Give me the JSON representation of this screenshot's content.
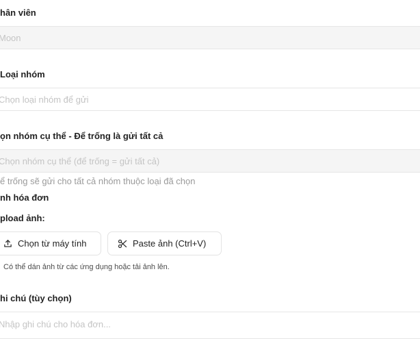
{
  "employee": {
    "label": "hân viên",
    "value": "Moon"
  },
  "group_type": {
    "label": "Loại nhóm",
    "placeholder": "Chọn loại nhóm để gửi"
  },
  "specific_group": {
    "label": "ọn nhóm cụ thể - Để trống là gửi tất cả",
    "placeholder": "Chọn nhóm cụ thể (để trống = gửi tất cả)",
    "hint": "ể trống sẽ gửi cho tất cả nhóm thuộc loại đã chọn"
  },
  "invoice_image": {
    "section_label": "nh hóa đơn",
    "upload_label": "pload ảnh:",
    "choose_button": "Chọn từ máy tính",
    "paste_button": "Paste ảnh (Ctrl+V)",
    "help_text": "Có thể dán ảnh từ các ứng dụng hoặc tải ảnh lên."
  },
  "note": {
    "label": "hi chú (tùy chọn)",
    "placeholder": "Nhập ghi chú cho hóa đơn..."
  },
  "icons": {
    "upload": "upload-icon",
    "paste": "scissors-icon"
  }
}
